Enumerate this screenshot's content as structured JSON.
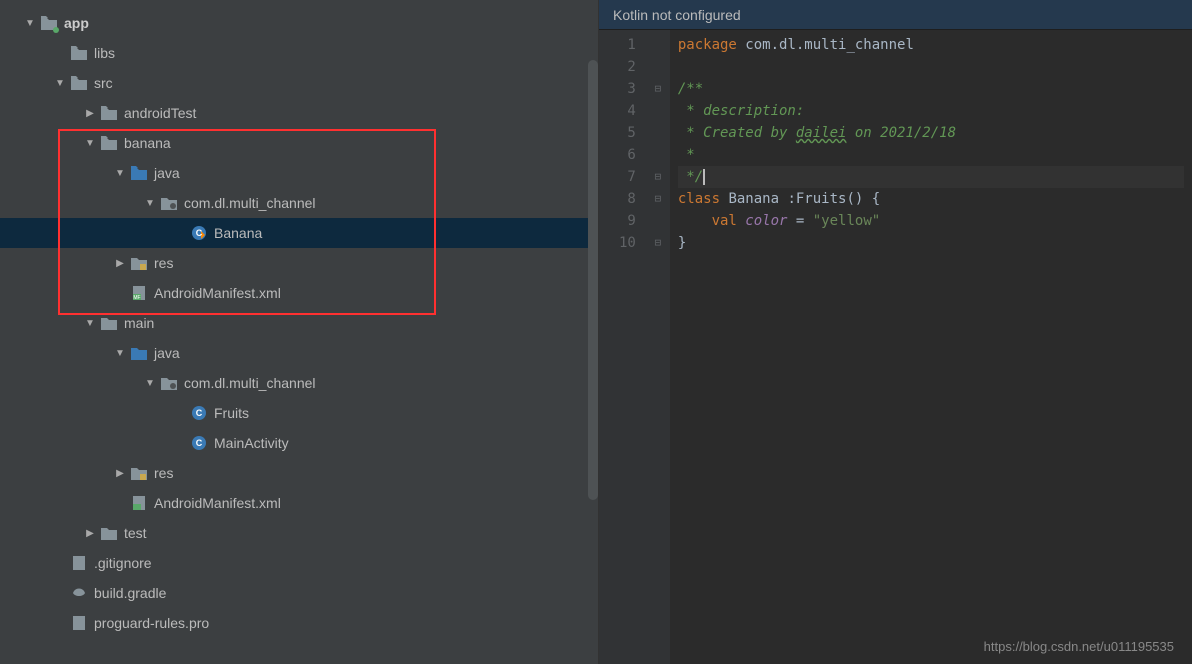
{
  "banner": {
    "text": "Kotlin not configured"
  },
  "tree": {
    "app": "app",
    "libs": "libs",
    "src": "src",
    "androidTest": "androidTest",
    "banana": "banana",
    "java": "java",
    "package": "com.dl.multi_channel",
    "banana_class": "Banana",
    "res": "res",
    "manifest": "AndroidManifest.xml",
    "main": "main",
    "fruits": "Fruits",
    "mainactivity": "MainActivity",
    "test": "test",
    "gitignore": ".gitignore",
    "buildgradle": "build.gradle",
    "proguard": "proguard-rules.pro"
  },
  "code": {
    "line1_kw": "package",
    "line1_pkg": " com.dl.multi_channel",
    "line3": "/**",
    "line4": " * description:",
    "line5a": " * Created by ",
    "line5b": "dailei",
    "line5c": " on 2021/2/18",
    "line6": " *",
    "line7": " */",
    "line8_kw": "class",
    "line8_name": " Banana ",
    "line8_rest": ":Fruits() {",
    "line9_kw": "    val",
    "line9_ident": " color",
    "line9_eq": " = ",
    "line9_str": "\"yellow\"",
    "line10": "}"
  },
  "lines": [
    "1",
    "2",
    "3",
    "4",
    "5",
    "6",
    "7",
    "8",
    "9",
    "10"
  ],
  "watermark": "https://blog.csdn.net/u011195535"
}
